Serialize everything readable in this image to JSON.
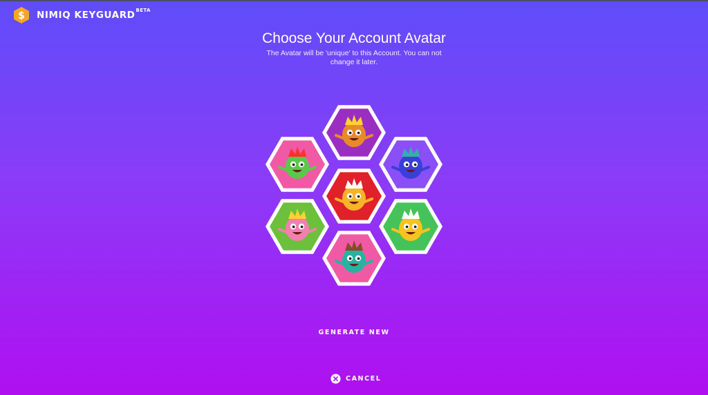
{
  "header": {
    "brand": "NIMIQ KEYGUARD",
    "badge": "BETA",
    "logo_icon": "nimiq-hexagon-logo",
    "logo_color": "#f5a623"
  },
  "main": {
    "title": "Choose Your Account Avatar",
    "subtitle": "The Avatar will be 'unique' to this Account. You can not change it later."
  },
  "avatars": [
    {
      "id": "top",
      "background": "#9b2ec2",
      "body": "#e98a2a",
      "accent": "#ffd230",
      "icon": "avatar-crowned-orange-monster"
    },
    {
      "id": "upper-left",
      "background": "#f05aa5",
      "body": "#5cc84a",
      "accent": "#ff3030",
      "icon": "avatar-crowned-green-monster"
    },
    {
      "id": "upper-right",
      "background": "#8a4ff7",
      "body": "#3a3fd8",
      "accent": "#2fb3a8",
      "icon": "avatar-blue-pirate-monster"
    },
    {
      "id": "center",
      "background": "#e0202a",
      "body": "#f7b329",
      "accent": "#ffffff",
      "icon": "avatar-mushroom-hat-octopus"
    },
    {
      "id": "lower-left",
      "background": "#6cc03c",
      "body": "#f27fb0",
      "accent": "#ffd230",
      "icon": "avatar-crowned-pink-bird"
    },
    {
      "id": "lower-right",
      "background": "#45c35a",
      "body": "#f7c31f",
      "accent": "#ffffff",
      "icon": "avatar-sailor-hat-monster"
    },
    {
      "id": "bottom",
      "background": "#f05aa5",
      "body": "#27b3a0",
      "accent": "#8a4b2a",
      "icon": "avatar-teal-mustache-monster"
    }
  ],
  "actions": {
    "generate_new": "GENERATE NEW",
    "cancel": "CANCEL",
    "cancel_icon": "close-circle-icon"
  },
  "colors": {
    "gradient_top": "#5f4df9",
    "gradient_bottom": "#b00ff0",
    "hex_border": "#ffffff"
  }
}
